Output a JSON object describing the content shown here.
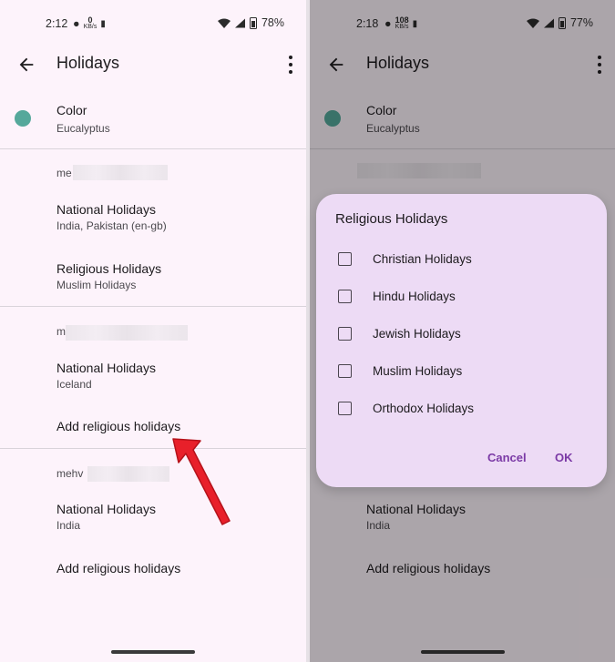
{
  "left": {
    "status": {
      "time": "2:12",
      "net_value": "0",
      "net_unit": "KB/s",
      "battery": "78%"
    },
    "appbar": {
      "title": "Holidays"
    },
    "color": {
      "title": "Color",
      "value": "Eucalyptus"
    },
    "account1": {
      "label": "me",
      "national": {
        "title": "National Holidays",
        "subtitle": "India, Pakistan (en-gb)"
      },
      "religious": {
        "title": "Religious Holidays",
        "subtitle": "Muslim Holidays"
      }
    },
    "account2": {
      "label": "m",
      "national": {
        "title": "National Holidays",
        "subtitle": "Iceland"
      },
      "add_religious": "Add religious holidays"
    },
    "account3": {
      "label": "mehv",
      "national": {
        "title": "National Holidays",
        "subtitle": "India"
      },
      "add_religious": "Add religious holidays"
    }
  },
  "right": {
    "status": {
      "time": "2:18",
      "net_value": "108",
      "net_unit": "KB/s",
      "battery": "77%"
    },
    "appbar": {
      "title": "Holidays"
    },
    "color": {
      "title": "Color",
      "value": "Eucalyptus"
    },
    "account3": {
      "national": {
        "title": "National Holidays",
        "subtitle": "India"
      },
      "add_religious": "Add religious holidays"
    }
  },
  "dialog": {
    "title": "Religious Holidays",
    "options": [
      {
        "label": "Christian Holidays",
        "checked": false
      },
      {
        "label": "Hindu Holidays",
        "checked": false
      },
      {
        "label": "Jewish Holidays",
        "checked": false
      },
      {
        "label": "Muslim Holidays",
        "checked": false
      },
      {
        "label": "Orthodox Holidays",
        "checked": false
      }
    ],
    "cancel": "Cancel",
    "ok": "OK"
  },
  "colors": {
    "accent": "#7b3aa6",
    "eucalyptus": "#55a89b",
    "annotation_arrow": "#e8202a"
  }
}
